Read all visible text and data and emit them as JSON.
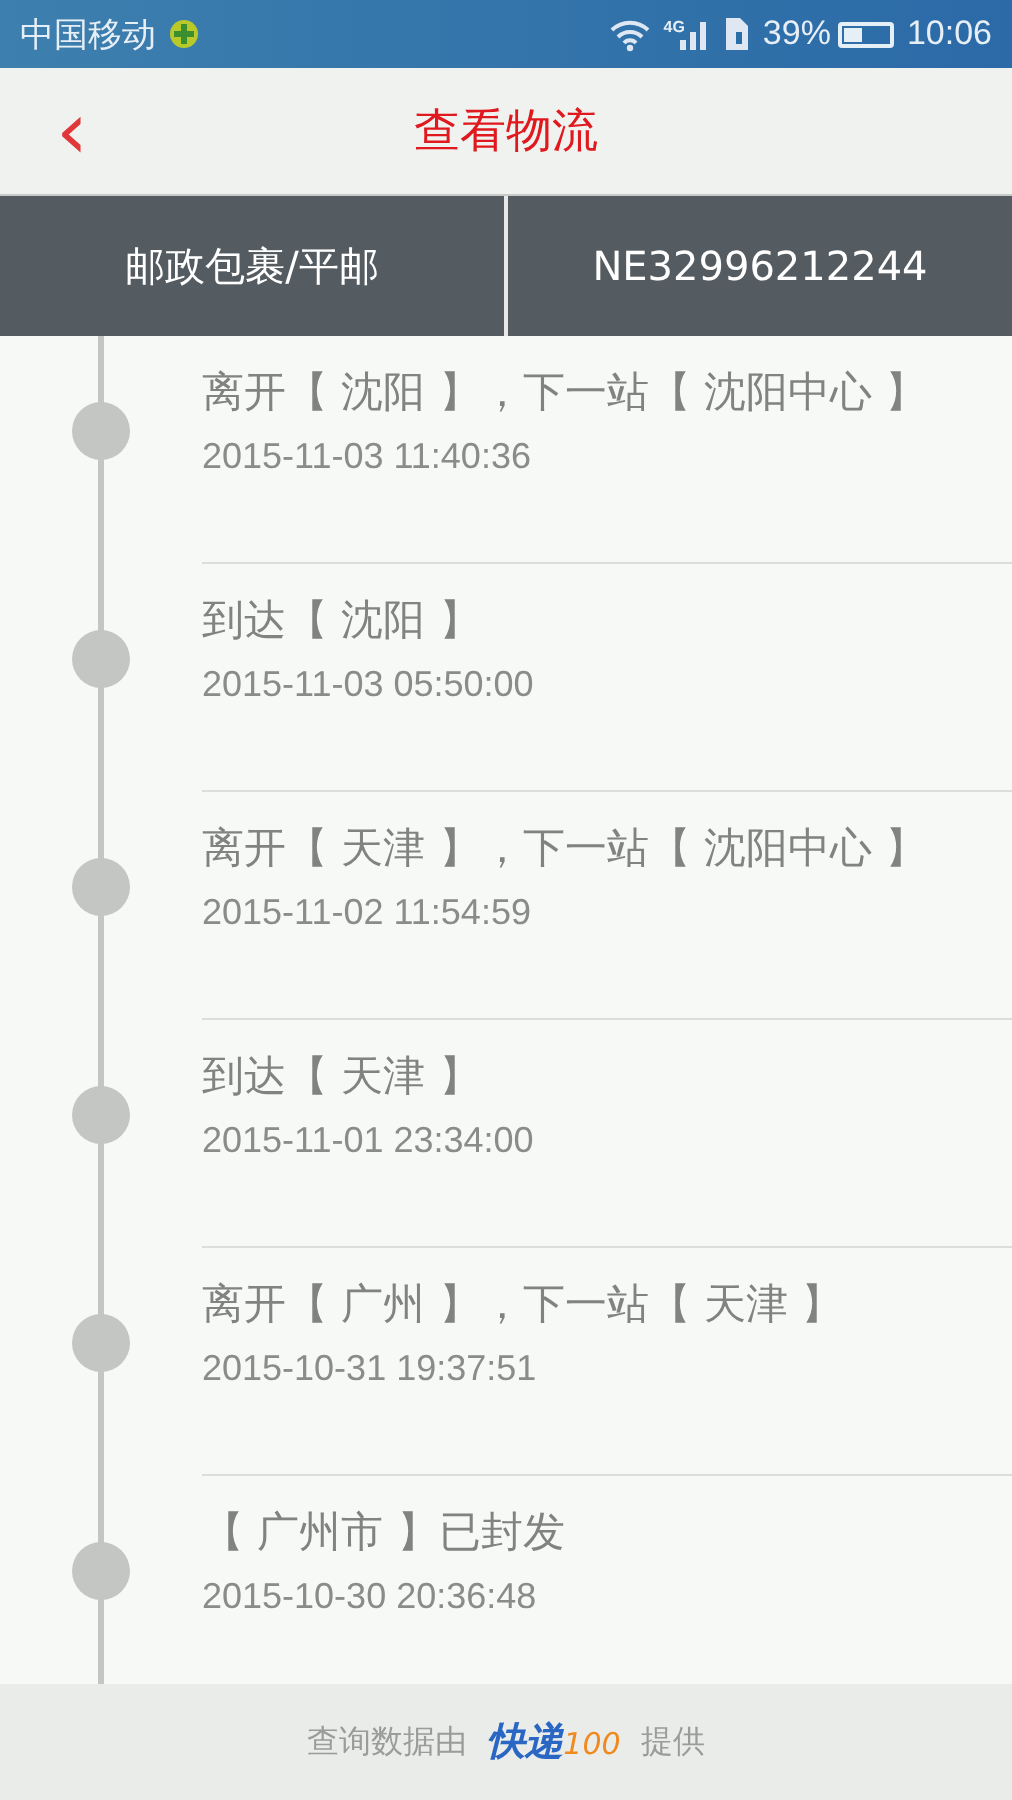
{
  "status_bar": {
    "carrier": "中国移动",
    "network": "4G",
    "battery": "39%",
    "time": "10:06"
  },
  "header": {
    "back": "‹",
    "title": "查看物流"
  },
  "tabs": [
    {
      "label": "邮政包裹/平邮"
    },
    {
      "label": "NE32996212244"
    }
  ],
  "events": [
    {
      "text": "离开【 沈阳 】，下一站【 沈阳中心 】",
      "time": "2015-11-03 11:40:36"
    },
    {
      "text": "到达【 沈阳 】",
      "time": "2015-11-03 05:50:00"
    },
    {
      "text": "离开【 天津 】，下一站【 沈阳中心 】",
      "time": "2015-11-02 11:54:59"
    },
    {
      "text": "到达【 天津 】",
      "time": "2015-11-01 23:34:00"
    },
    {
      "text": "离开【 广州 】，下一站【 天津 】",
      "time": "2015-10-31 19:37:51"
    },
    {
      "text": "【 广州市 】已封发",
      "time": "2015-10-30 20:36:48"
    }
  ],
  "footer": {
    "before": "查询数据由",
    "logo_main": "快递",
    "logo_num": "100",
    "after": "提供"
  }
}
